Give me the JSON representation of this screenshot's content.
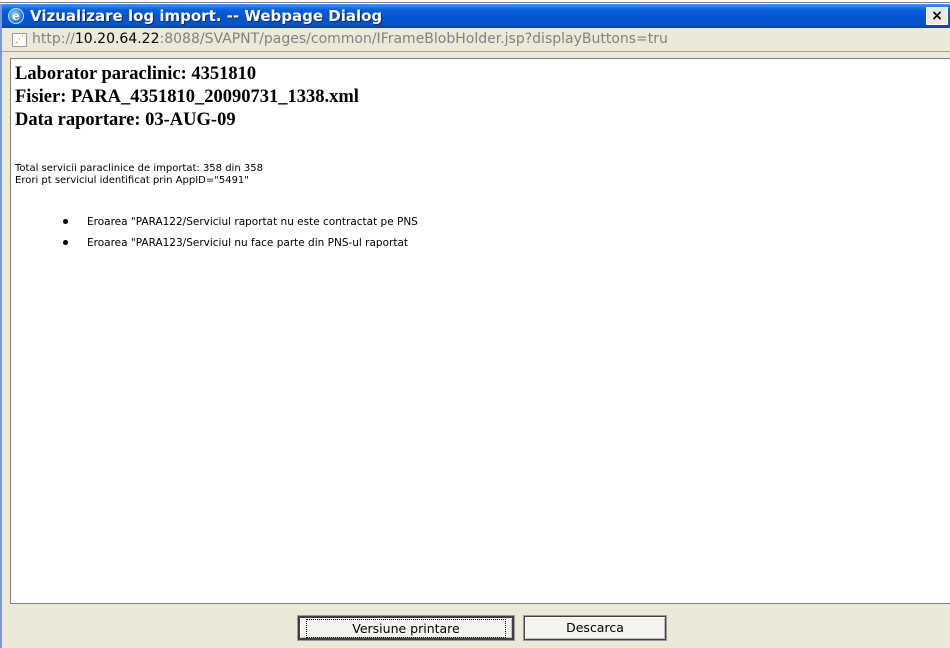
{
  "window": {
    "title": "Vizualizare log import. -- Webpage Dialog",
    "close_label": "×"
  },
  "address": {
    "scheme": "http://",
    "host": "10.20.64.22",
    "path": ":8088/SVAPNT/pages/common/IFrameBlobHolder.jsp?displayButtons=tru"
  },
  "content": {
    "heading_lab": "Laborator paraclinic: 4351810",
    "heading_file": "Fisier: PARA_4351810_20090731_1338.xml",
    "heading_date": "Data raportare: 03-AUG-09",
    "total_line": "Total servicii paraclinice de importat: 358 din 358",
    "errors_line": "Erori pt serviciul identificat prin AppID=\"5491\"",
    "error_items": [
      "Eroarea \"PARA122/Serviciul raportat nu este contractat pe PNS",
      "Eroarea \"PARA123/Serviciul nu face parte din PNS-ul raportat"
    ]
  },
  "buttons": {
    "print_label": "Versiune printare",
    "download_label": "Descarca"
  },
  "colors": {
    "titlebar": "#0554d3",
    "dialog_bg": "#ece9d8"
  },
  "icons": {
    "window": "ie-icon",
    "page": "page-icon",
    "close": "close-icon"
  }
}
